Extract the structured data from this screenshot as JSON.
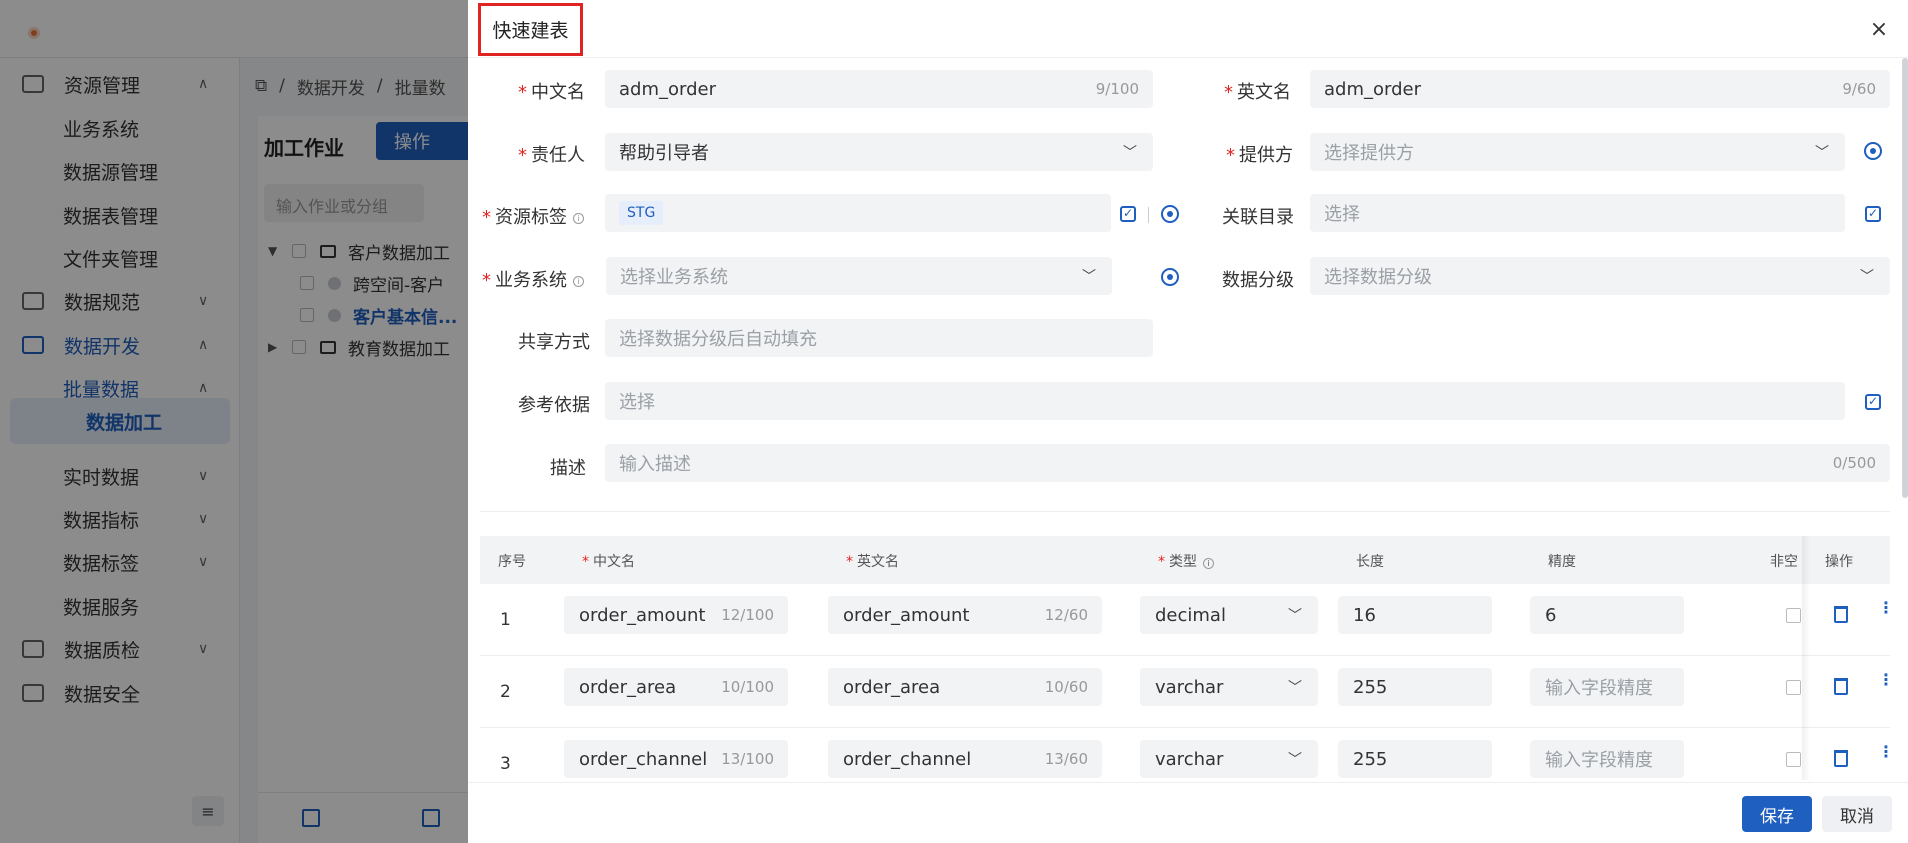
{
  "sidebar": {
    "items": [
      {
        "label": "资源管理",
        "chevron": "∧"
      },
      {
        "label": "业务系统"
      },
      {
        "label": "数据源管理"
      },
      {
        "label": "数据表管理"
      },
      {
        "label": "文件夹管理"
      },
      {
        "label": "数据规范",
        "chevron": "∨"
      },
      {
        "label": "数据开发",
        "chevron": "∧"
      },
      {
        "label": "批量数据",
        "chevron": "∧"
      },
      {
        "label": "数据加工"
      },
      {
        "label": "实时数据",
        "chevron": "∨"
      },
      {
        "label": "数据指标",
        "chevron": "∨"
      },
      {
        "label": "数据标签",
        "chevron": "∨"
      },
      {
        "label": "数据服务"
      },
      {
        "label": "数据质检",
        "chevron": "∨"
      },
      {
        "label": "数据安全"
      }
    ],
    "collapse_icon": "≡"
  },
  "breadcrumb": {
    "sep": "/",
    "items": [
      "数据开发",
      "批量数"
    ]
  },
  "work_panel": {
    "title": "加工作业",
    "ops_label": "操作",
    "search_placeholder": "输入作业或分组",
    "tree": [
      {
        "label": "客户数据加工"
      },
      {
        "label": "跨空间-客户"
      },
      {
        "label": "客户基本信..."
      },
      {
        "label": "教育数据加工"
      }
    ]
  },
  "drawer": {
    "title": "快速建表",
    "close": "×",
    "fields": {
      "cn_name": {
        "label": "中文名",
        "value": "adm_order",
        "count": "9/100"
      },
      "en_name": {
        "label": "英文名",
        "value": "adm_order",
        "count": "9/60"
      },
      "owner": {
        "label": "责任人",
        "value": "帮助引导者"
      },
      "provider": {
        "label": "提供方",
        "placeholder": "选择提供方"
      },
      "resource_tag": {
        "label": "资源标签",
        "tag": "STG"
      },
      "catalog": {
        "label": "关联目录",
        "placeholder": "选择"
      },
      "biz_system": {
        "label": "业务系统",
        "placeholder": "选择业务系统"
      },
      "data_level": {
        "label": "数据分级",
        "placeholder": "选择数据分级"
      },
      "share": {
        "label": "共享方式",
        "placeholder": "选择数据分级后自动填充"
      },
      "reference": {
        "label": "参考依据",
        "placeholder": "选择"
      },
      "desc": {
        "label": "描述",
        "placeholder": "输入描述",
        "count": "0/500"
      }
    },
    "table": {
      "headers": {
        "idx": "序号",
        "cn": "中文名",
        "en": "英文名",
        "type": "类型",
        "length": "长度",
        "precision": "精度",
        "notnull": "非空",
        "ops": "操作"
      },
      "precision_placeholder": "输入字段精度",
      "rows": [
        {
          "idx": "1",
          "cn": "order_amount",
          "cn_count": "12/100",
          "en": "order_amount",
          "en_count": "12/60",
          "type": "decimal",
          "length": "16",
          "precision": "6"
        },
        {
          "idx": "2",
          "cn": "order_area",
          "cn_count": "10/100",
          "en": "order_area",
          "en_count": "10/60",
          "type": "varchar",
          "length": "255",
          "precision": ""
        },
        {
          "idx": "3",
          "cn": "order_channel",
          "cn_count": "13/100",
          "en": "order_channel",
          "en_count": "13/60",
          "type": "varchar",
          "length": "255",
          "precision": ""
        }
      ]
    },
    "save_label": "保存",
    "cancel_label": "取消"
  },
  "colors": {
    "primary": "#1f5fbf",
    "required": "#e02424",
    "highlight_border": "#e02424"
  }
}
